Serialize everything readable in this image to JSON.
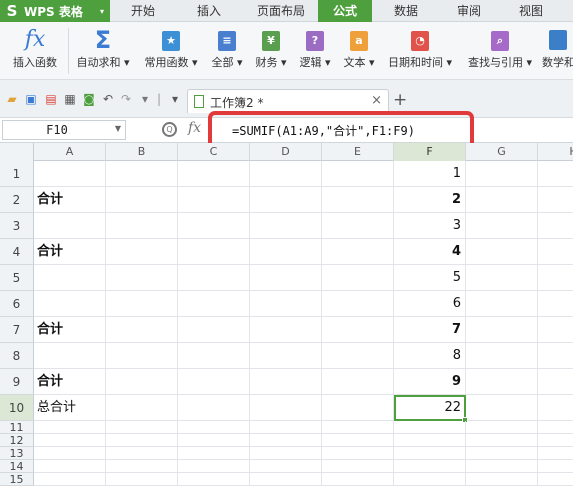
{
  "app": {
    "name": "WPS 表格",
    "logo_glyph": "S",
    "dropdown_glyph": "▾",
    "accent_color": "#4e9f3d"
  },
  "menu_tabs": [
    {
      "label": "开始",
      "active": false
    },
    {
      "label": "插入",
      "active": false
    },
    {
      "label": "页面布局",
      "active": false
    },
    {
      "label": "公式",
      "active": true
    },
    {
      "label": "数据",
      "active": false
    },
    {
      "label": "审阅",
      "active": false
    },
    {
      "label": "视图",
      "active": false
    }
  ],
  "ribbon": {
    "insert_function": {
      "label": "插入函数",
      "icon": "fx-icon",
      "glyph": "fx"
    },
    "autosum": {
      "label": "自动求和 ▾",
      "icon": "sigma-icon",
      "glyph": "Σ"
    },
    "common_functions": {
      "label": "常用函数 ▾",
      "icon": "star-icon",
      "glyph": "★"
    },
    "all_functions": {
      "label": "全部 ▾",
      "icon": "list-icon",
      "glyph": "≡"
    },
    "financial": {
      "label": "财务 ▾",
      "icon": "finance-icon",
      "glyph": "¥"
    },
    "logical": {
      "label": "逻辑 ▾",
      "icon": "logic-icon",
      "glyph": "?"
    },
    "text": {
      "label": "文本 ▾",
      "icon": "text-icon",
      "glyph": "a"
    },
    "datetime": {
      "label": "日期和时间 ▾",
      "icon": "clock-icon",
      "glyph": "◔"
    },
    "lookup": {
      "label": "查找与引用 ▾",
      "icon": "lookup-icon",
      "glyph": "⌕"
    },
    "math": {
      "label": "数学和"
    }
  },
  "toolbar": {
    "doc_tab_title": "工作簿2 *",
    "close_glyph": "×",
    "new_tab_glyph": "+"
  },
  "formula_bar": {
    "name_box": "F10",
    "fx_glyph": "fx",
    "formula": "=SUMIF(A1:A9,\"合计\",F1:F9)"
  },
  "sheet": {
    "columns": [
      "A",
      "B",
      "C",
      "D",
      "E",
      "F",
      "G",
      "H"
    ],
    "selected_column": "F",
    "rows": [
      {
        "num": "1",
        "a": "",
        "f": "1",
        "bold": false
      },
      {
        "num": "2",
        "a": "合计",
        "f": "2",
        "bold": true
      },
      {
        "num": "3",
        "a": "",
        "f": "3",
        "bold": false
      },
      {
        "num": "4",
        "a": "合计",
        "f": "4",
        "bold": true
      },
      {
        "num": "5",
        "a": "",
        "f": "5",
        "bold": false
      },
      {
        "num": "6",
        "a": "",
        "f": "6",
        "bold": false
      },
      {
        "num": "7",
        "a": "合计",
        "f": "7",
        "bold": true
      },
      {
        "num": "8",
        "a": "",
        "f": "8",
        "bold": false
      },
      {
        "num": "9",
        "a": "合计",
        "f": "9",
        "bold": true
      },
      {
        "num": "10",
        "a": "总合计",
        "f": "22",
        "bold": false
      },
      {
        "num": "11",
        "a": "",
        "f": "",
        "bold": false
      },
      {
        "num": "12",
        "a": "",
        "f": "",
        "bold": false
      },
      {
        "num": "13",
        "a": "",
        "f": "",
        "bold": false
      },
      {
        "num": "14",
        "a": "",
        "f": "",
        "bold": false
      },
      {
        "num": "15",
        "a": "",
        "f": "",
        "bold": false
      }
    ],
    "active_row": "10"
  }
}
